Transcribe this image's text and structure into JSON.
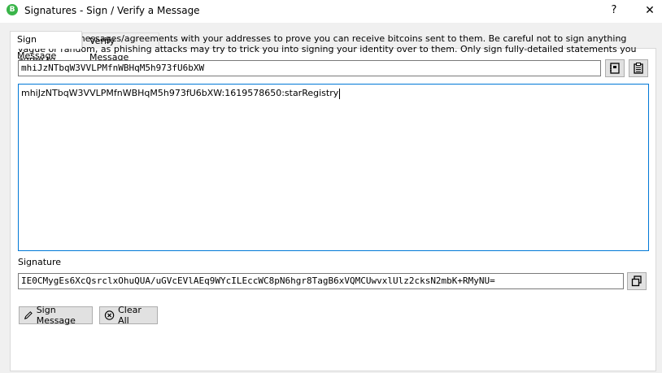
{
  "window": {
    "app_icon_letter": "B",
    "title": "Signatures - Sign / Verify a Message",
    "help_glyph": "?",
    "close_glyph": "✕"
  },
  "tabs": [
    {
      "label": "Sign Message",
      "active": true
    },
    {
      "label": "Verify Message",
      "active": false
    }
  ],
  "sign": {
    "description": "You can sign messages/agreements with your addresses to prove you can receive bitcoins sent to them. Be careful not to sign anything vague or random, as phishing attacks may try to trick you into signing your identity over to them. Only sign fully-detailed statements you agree to.",
    "address_value": "mhiJzNTbqW3VVLPMfnWBHqM5h973fU6bXW",
    "address_book_icon": "address-book-icon",
    "paste_icon": "paste-icon",
    "message_value": "mhiJzNTbqW3VVLPMfnWBHqM5h973fU6bXW:1619578650:starRegistry",
    "signature_label": "Signature",
    "signature_value": "IE0CMygEs6XcQsrclxOhuQUA/uGVcEVlAEq9WYcILEccWC8pN6hgr8TagB6xVQMCUwvxlUlz2cksN2mbK+RMyNU=",
    "copy_icon": "copy-icon",
    "sign_button_label": "Sign Message",
    "clear_button_label": "Clear All"
  }
}
